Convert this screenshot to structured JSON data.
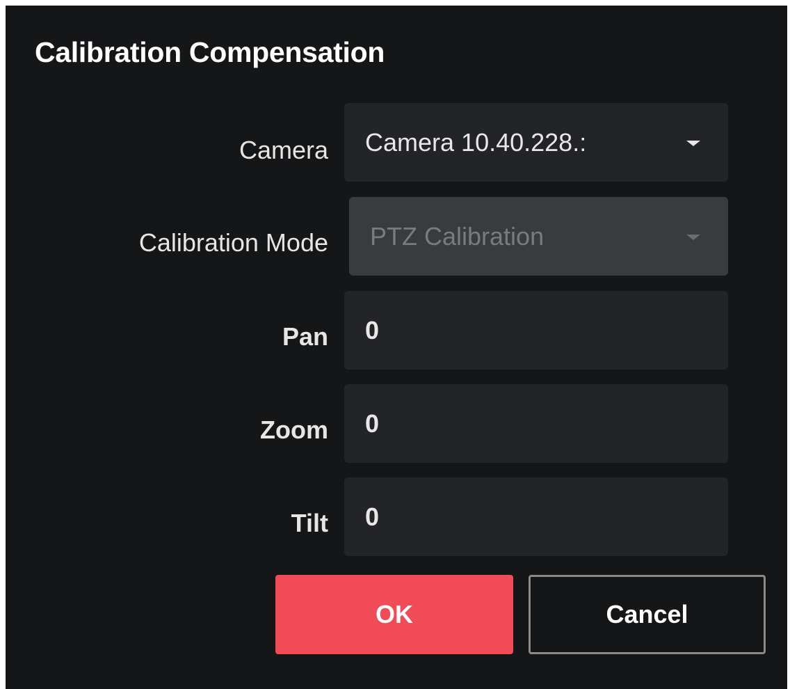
{
  "dialog": {
    "title": "Calibration Compensation"
  },
  "form": {
    "camera": {
      "label": "Camera",
      "value": "Camera 10.40.228.:"
    },
    "calibration_mode": {
      "label": "Calibration Mode",
      "value": "PTZ Calibration",
      "disabled": true
    },
    "pan": {
      "label": "Pan",
      "value": "0"
    },
    "zoom": {
      "label": "Zoom",
      "value": "0"
    },
    "tilt": {
      "label": "Tilt",
      "value": "0"
    }
  },
  "buttons": {
    "ok_label": "OK",
    "cancel_label": "Cancel"
  },
  "colors": {
    "background": "#151618",
    "field": "#232427",
    "field_disabled": "#3a3b3e",
    "primary": "#f04b57",
    "cancel_border": "#8a8a8a"
  },
  "icons": {
    "dropdown": "chevron-down-icon"
  }
}
